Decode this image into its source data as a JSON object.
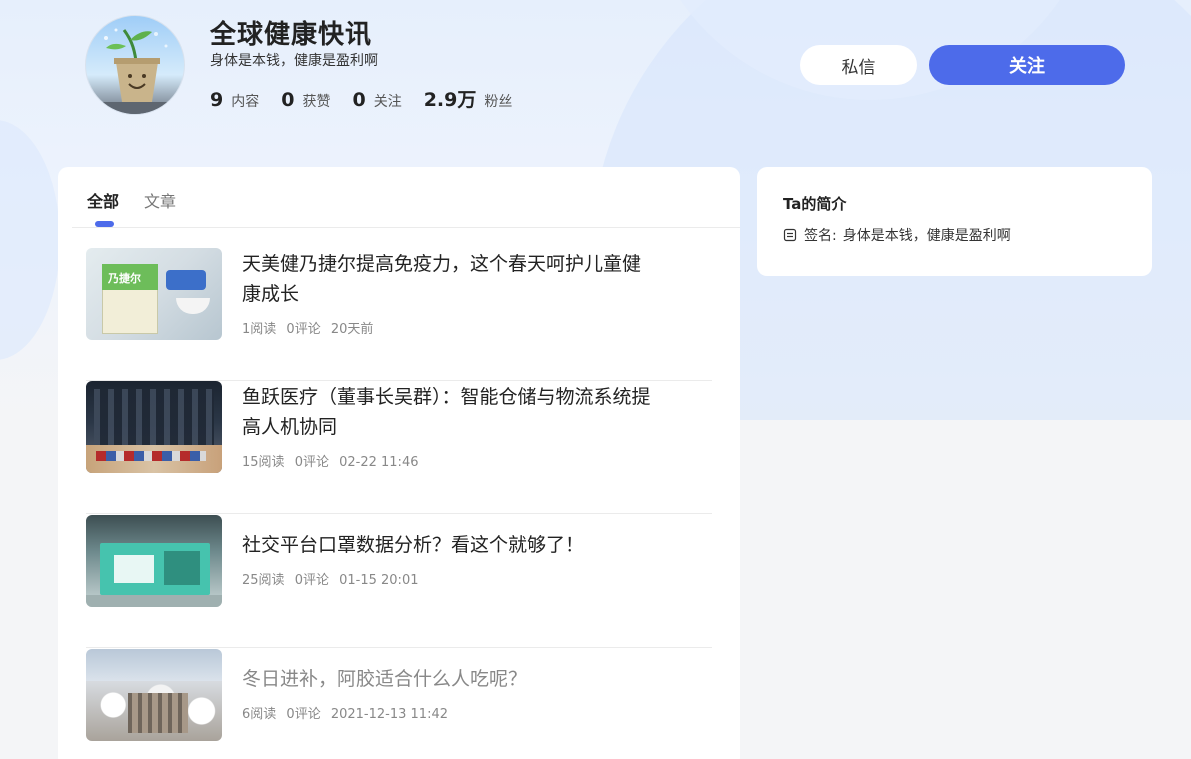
{
  "profile": {
    "name": "全球健康快讯",
    "signature": "身体是本钱，健康是盈利啊",
    "stats": [
      {
        "value": "9",
        "label": "内容"
      },
      {
        "value": "0",
        "label": "获赞"
      },
      {
        "value": "0",
        "label": "关注"
      },
      {
        "value": "2.9万",
        "label": "粉丝"
      }
    ]
  },
  "actions": {
    "message_label": "私信",
    "follow_label": "关注"
  },
  "tabs": [
    {
      "label": "全部",
      "active": true
    },
    {
      "label": "文章",
      "active": false
    }
  ],
  "articles": [
    {
      "title": "天美健乃捷尔提高免疫力，这个春天呵护儿童健康成长",
      "reads": "1阅读",
      "comments": "0评论",
      "time": "20天前",
      "thumb_text": "乃捷尔"
    },
    {
      "title": "鱼跃医疗（董事长吴群）：智能仓储与物流系统提高人机协同",
      "reads": "15阅读",
      "comments": "0评论",
      "time": "02-22 11:46"
    },
    {
      "title": "社交平台口罩数据分析？看这个就够了！",
      "reads": "25阅读",
      "comments": "0评论",
      "time": "01-15 20:01"
    },
    {
      "title": "冬日进补，阿胶适合什么人吃呢？",
      "reads": "6阅读",
      "comments": "0评论",
      "time": "2021-12-13 11:42"
    }
  ],
  "intro": {
    "title": "Ta的简介",
    "signature_label": "签名:",
    "signature_value": "身体是本钱，健康是盈利啊"
  },
  "colors": {
    "accent": "#4d6bea",
    "background": "#f4f5f7"
  }
}
